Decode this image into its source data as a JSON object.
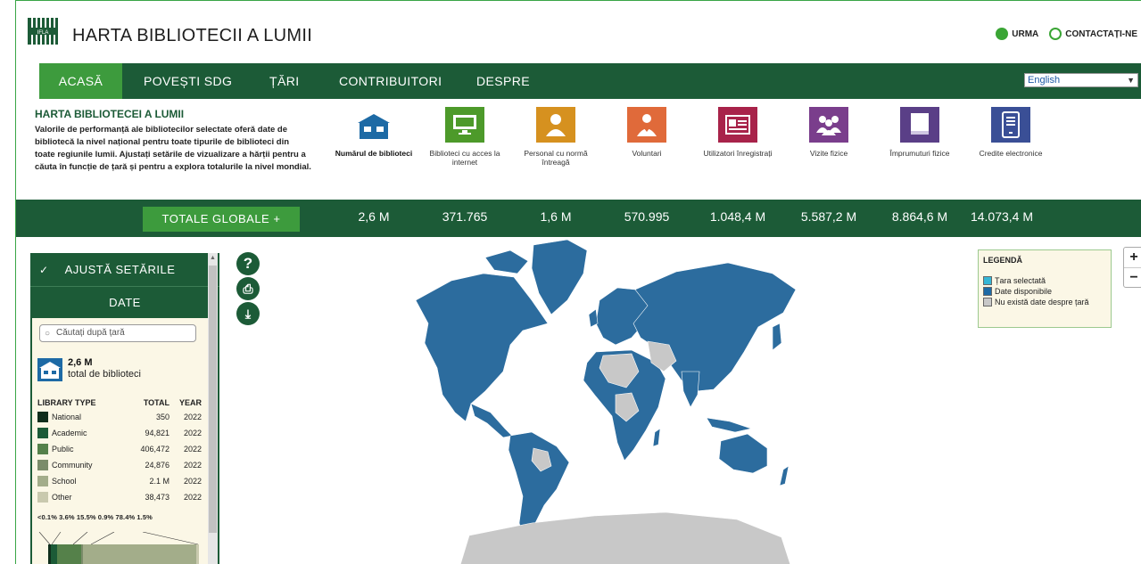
{
  "header": {
    "title": "HARTA BIBLIOTECII A LUMII",
    "logo_text": "IFLA",
    "links": [
      {
        "label": "URMA",
        "icon": "follow-icon"
      },
      {
        "label": "CONTACTAȚI-NE",
        "icon": "mail-icon"
      }
    ]
  },
  "nav": {
    "items": [
      {
        "label": "ACASĂ",
        "active": true
      },
      {
        "label": "POVEȘTI SDG"
      },
      {
        "label": "ȚĂRI"
      },
      {
        "label": "CONTRIBUITORI"
      },
      {
        "label": "DESPRE"
      }
    ],
    "language": "English"
  },
  "intro": {
    "title": "HARTA BIBLIOTECEI A LUMII",
    "text": "Valorile de performanță ale bibliotecilor selectate oferă date de bibliotecă la nivel național pentru toate tipurile de biblioteci din toate regiunile lumii. Ajustați setările de vizualizare a hărții pentru a căuta în funcție de țară și pentru a explora totalurile la nivel mondial."
  },
  "metrics": [
    {
      "label": "Numărul de biblioteci",
      "color": "#1d6aa5",
      "icon": "library-icon",
      "total": "2,6 M",
      "selected": true
    },
    {
      "label": "Biblioteci cu acces la internet",
      "color": "#4d9a2a",
      "icon": "computer-icon",
      "total": "371.765"
    },
    {
      "label": "Personal cu normă întreagă",
      "color": "#d6911f",
      "icon": "staff-icon",
      "total": "1,6 M"
    },
    {
      "label": "Voluntari",
      "color": "#e06a3a",
      "icon": "volunteer-icon",
      "total": "570.995"
    },
    {
      "label": "Utilizatori înregistrați",
      "color": "#a8234a",
      "icon": "card-icon",
      "total": "1.048,4 M"
    },
    {
      "label": "Vizite fizice",
      "color": "#7a3e8c",
      "icon": "visitors-icon",
      "total": "5.587,2 M"
    },
    {
      "label": "Împrumuturi fizice",
      "color": "#5a3f87",
      "icon": "book-icon",
      "total": "8.864,6 M"
    },
    {
      "label": "Credite electronice",
      "color": "#3a4f96",
      "icon": "ebook-icon",
      "total": "14.073,4 M"
    }
  ],
  "totals": {
    "button_label": "TOTALE GLOBALE +"
  },
  "panel": {
    "header": "AJUSTĂ SETĂRILE",
    "tab": "DATE",
    "search_placeholder": "Căutați după țară",
    "summary_value": "2,6 M",
    "summary_label": "total de biblioteci",
    "table_headers": [
      "LIBRARY TYPE",
      "TOTAL",
      "YEAR"
    ],
    "rows": [
      {
        "type": "National",
        "total": "350",
        "year": "2022",
        "color": "#0f2e1c"
      },
      {
        "type": "Academic",
        "total": "94,821",
        "year": "2022",
        "color": "#1c5b37"
      },
      {
        "type": "Public",
        "total": "406,472",
        "year": "2022",
        "color": "#55814a"
      },
      {
        "type": "Community",
        "total": "24,876",
        "year": "2022",
        "color": "#7b8c6a"
      },
      {
        "type": "School",
        "total": "2.1 M",
        "year": "2022",
        "color": "#a3ad8a"
      },
      {
        "type": "Other",
        "total": "38,473",
        "year": "2022",
        "color": "#c9c9ae"
      }
    ],
    "percentages": "<0.1%  3.6%  15.5%  0.9%  78.4%  1.5%"
  },
  "tools": [
    {
      "name": "help-icon",
      "glyph": "?"
    },
    {
      "name": "print-icon",
      "glyph": "⎙"
    },
    {
      "name": "download-icon",
      "glyph": "⤓"
    }
  ],
  "legend": {
    "title": "LEGENDĂ",
    "items": [
      {
        "label": "Țara selectată",
        "color": "#35b6d6"
      },
      {
        "label": "Date disponibile",
        "color": "#1d6aa5"
      },
      {
        "label": "Nu există date despre țară",
        "color": "#c8c8c8"
      }
    ]
  },
  "zoom": {
    "in": "+",
    "out": "−"
  }
}
